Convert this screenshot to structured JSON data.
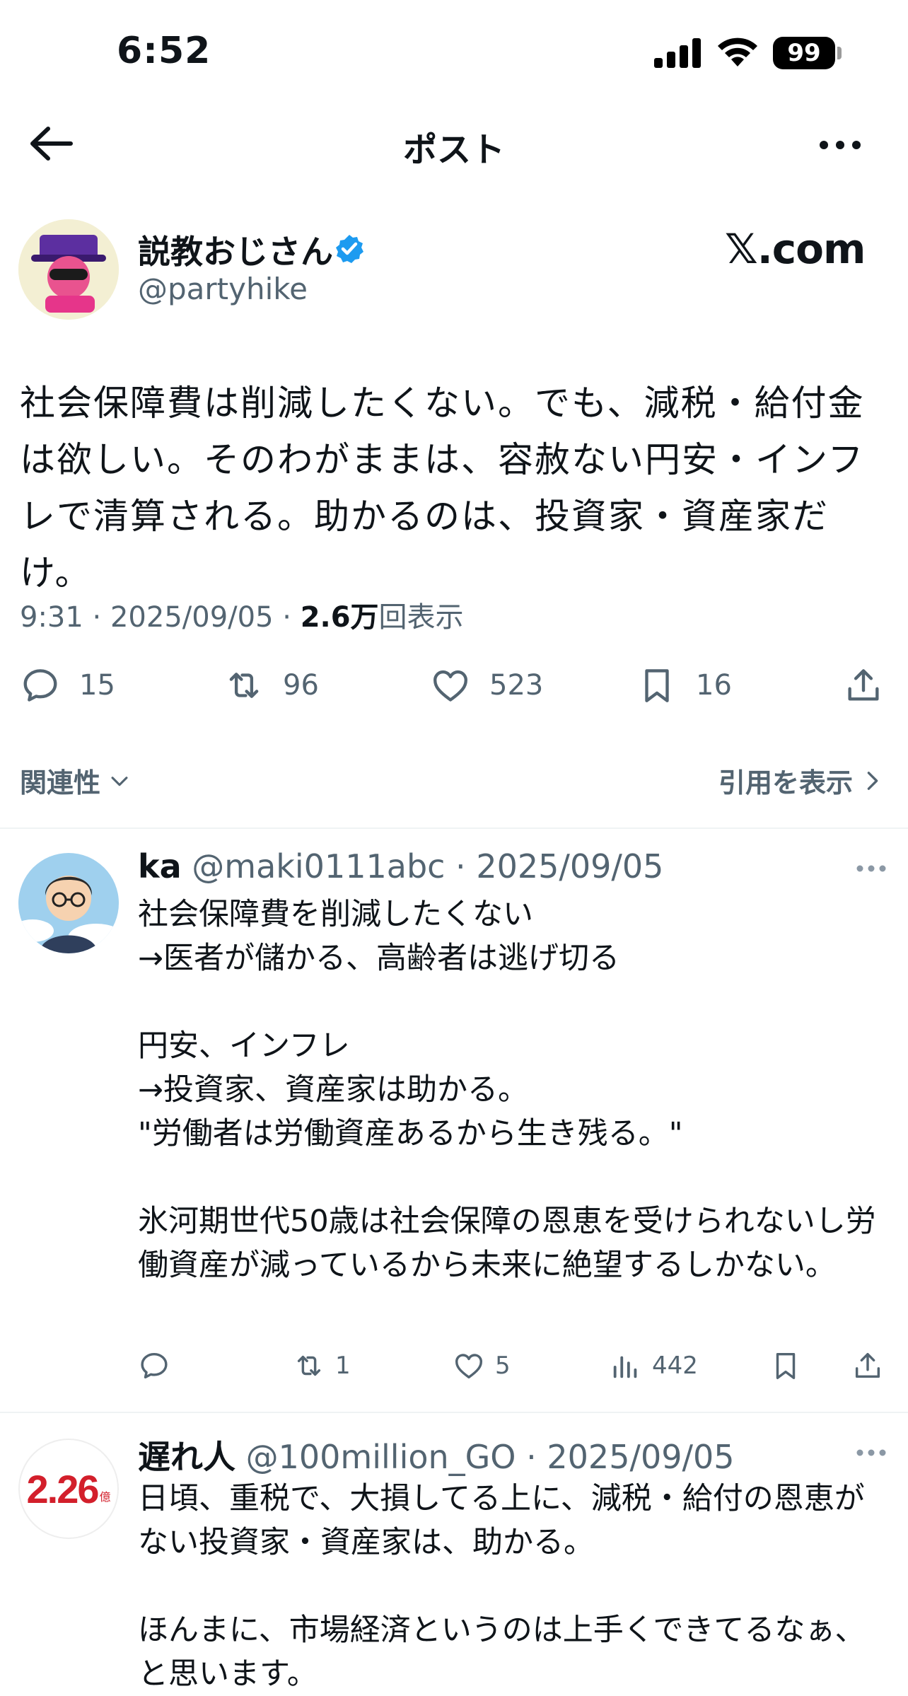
{
  "status_bar": {
    "time": "6:52",
    "battery": "99"
  },
  "header": {
    "title": "ポスト"
  },
  "post": {
    "author_name": "説教おじさん",
    "handle": "@partyhike",
    "brand": "𝕏.com",
    "text": "社会保障費は削減したくない。でも、減税・給付金は欲しい。そのわがままは、容赦ない円安・インフレで清算される。助かるのは、投資家・資産家だけ。",
    "time": "9:31",
    "date": "2025/09/05",
    "views": "2.6万",
    "views_suffix": "回表示",
    "replies": "15",
    "reposts": "96",
    "likes": "523",
    "bookmarks": "16"
  },
  "filters": {
    "sort_label": "関連性",
    "quotes_label": "引用を表示"
  },
  "replies": [
    {
      "name": "ka",
      "handle": "@maki0111abc",
      "date": "2025/09/05",
      "text": "社会保障費を削減したくない\n→医者が儲かる、高齢者は逃げ切る\n\n円安、インフレ\n→投資家、資産家は助かる。\n\"労働者は労働資産あるから生き残る。\"\n\n氷河期世代50歳は社会保障の恩恵を受けられないし労働資産が減っているから未来に絶望するしかない。",
      "reposts": "1",
      "likes": "5",
      "views": "442"
    },
    {
      "name": "遅れ人",
      "handle": "@100million_GO",
      "date": "2025/09/05",
      "avatar_text": "2.26",
      "avatar_sub": "億",
      "text": "日頃、重税で、大損してる上に、減税・給付の恩恵がない投資家・資産家は、助かる。\n\nほんまに、市場経済というのは上手くできてるなぁ、と思います。"
    }
  ],
  "icons": [
    "back-arrow-icon",
    "more-icon",
    "verified-badge-icon",
    "reply-icon",
    "repost-icon",
    "like-icon",
    "bookmark-icon",
    "share-icon",
    "views-icon",
    "chevron-down-icon",
    "chevron-right-icon"
  ],
  "colors": {
    "verified": "#1d9bf0",
    "muted": "#536471",
    "text": "#0f1419"
  }
}
